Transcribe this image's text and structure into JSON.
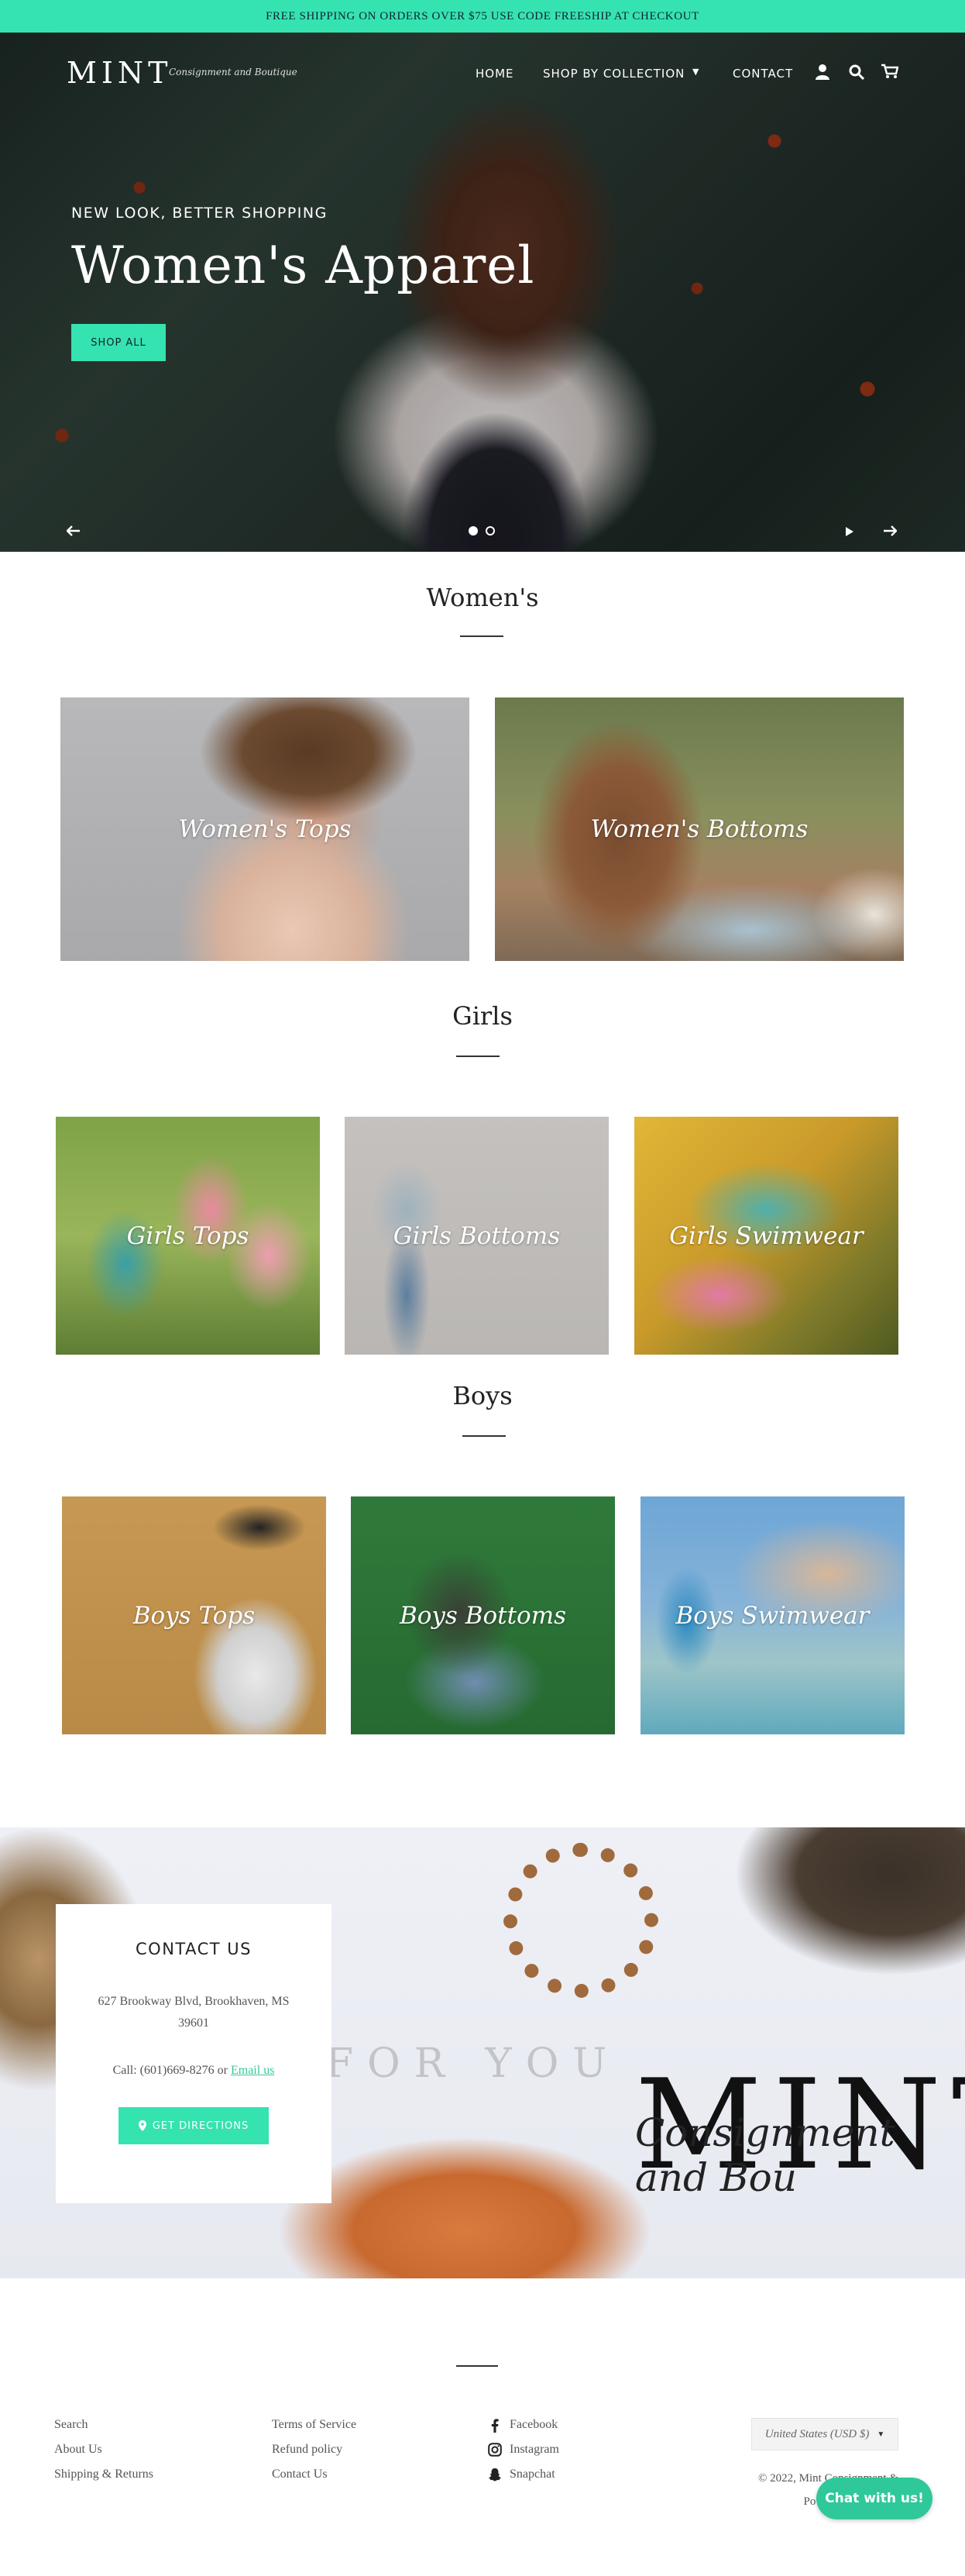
{
  "announcement": "FREE SHIPPING ON ORDERS OVER $75 USE CODE FREESHIP AT CHECKOUT",
  "header": {
    "logo": "MINT",
    "logo_script": "Consignment and Boutique",
    "nav": {
      "home": "HOME",
      "shop": "SHOP BY COLLECTION",
      "contact": "CONTACT"
    },
    "icons": [
      "account-icon",
      "search-icon",
      "cart-icon"
    ]
  },
  "hero": {
    "subtitle": "NEW LOOK, BETTER SHOPPING",
    "title": "Women's Apparel",
    "button": "SHOP ALL",
    "slide_count": 2,
    "active_slide": 1
  },
  "sections": {
    "womens": {
      "title": "Women's",
      "tiles": [
        "Women's Tops",
        "Women's Bottoms"
      ]
    },
    "girls": {
      "title": "Girls",
      "tiles": [
        "Girls Tops",
        "Girls Bottoms",
        "Girls Swimwear"
      ]
    },
    "boys": {
      "title": "Boys",
      "tiles": [
        "Boys Tops",
        "Boys Bottoms",
        "Boys Swimwear"
      ]
    }
  },
  "contact": {
    "title": "CONTACT US",
    "address": "627 Brookway Blvd, Brookhaven, MS 39601",
    "call_prefix": "Call: (601)669-8276 or ",
    "email_link": "Email us",
    "button": "GET DIRECTIONS",
    "banner_logo": "MINT",
    "banner_script": "Consignment and Bou",
    "banner_overlay": "FOR YOU"
  },
  "footer": {
    "col1": [
      "Search",
      "About Us",
      "Shipping & Returns"
    ],
    "col2": [
      "Terms of Service",
      "Refund policy",
      "Contact Us"
    ],
    "social": [
      "Facebook",
      "Instagram",
      "Snapchat"
    ],
    "currency": "United States (USD $)",
    "copyright_line1": "© 2022, Mint Consignment &",
    "copyright_line2": "Powered by Shopify"
  },
  "chat": "Chat with us!",
  "colors": {
    "accent": "#35e3b0",
    "chat": "#2fc89a"
  }
}
